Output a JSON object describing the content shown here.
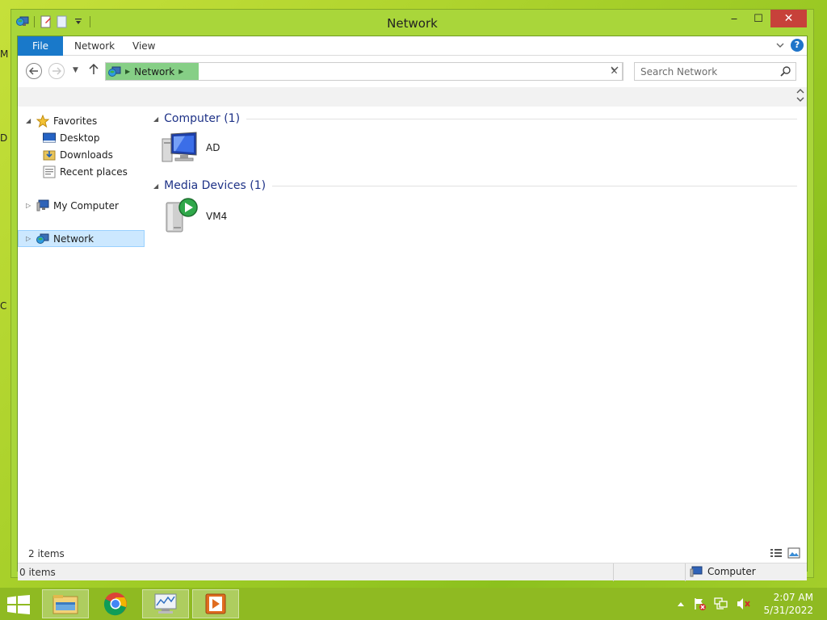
{
  "window": {
    "title": "Network",
    "minimize": "‒",
    "maximize": "☐",
    "close": "✕"
  },
  "ribbon": {
    "tabs": [
      "File",
      "Network",
      "View"
    ]
  },
  "address": {
    "crumb": "Network"
  },
  "search": {
    "placeholder": "Search Network"
  },
  "nav": {
    "favorites": "Favorites",
    "desktop": "Desktop",
    "downloads": "Downloads",
    "recent": "Recent places",
    "my_computer": "My Computer",
    "network": "Network"
  },
  "groups": [
    {
      "title": "Computer (1)",
      "items": [
        {
          "label": "AD",
          "icon": "computer-monitor-icon"
        }
      ]
    },
    {
      "title": "Media Devices (1)",
      "items": [
        {
          "label": "VM4",
          "icon": "media-device-icon"
        }
      ]
    }
  ],
  "status": {
    "items_count": "2 items",
    "selected_count": "0 items",
    "zone": "Computer"
  },
  "taskbar": {
    "time": "2:07 AM",
    "date": "5/31/2022"
  },
  "desktop_fragments": [
    "M",
    "D",
    "C"
  ]
}
